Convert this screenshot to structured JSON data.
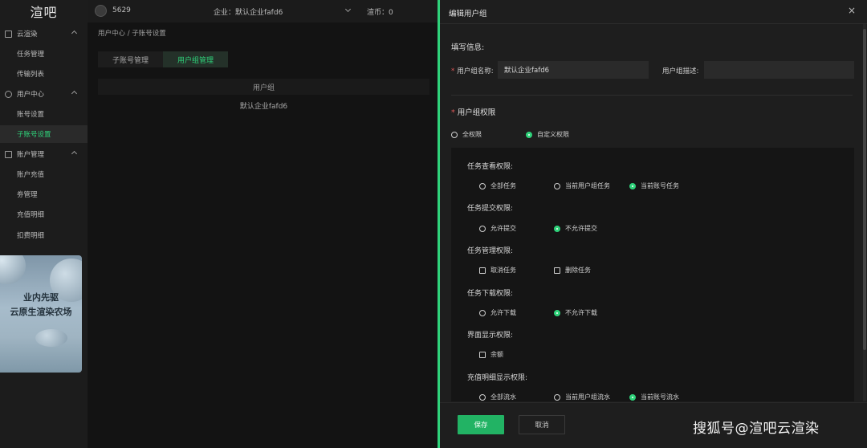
{
  "app": {
    "logo": "渲吧"
  },
  "sidebar": {
    "groups": [
      {
        "label": "云渲染",
        "items": [
          "任务管理",
          "传输列表"
        ]
      },
      {
        "label": "用户中心",
        "items": [
          "账号设置",
          "子账号设置"
        ]
      },
      {
        "label": "账户管理",
        "items": [
          "账户充值",
          "劵管理",
          "充值明细",
          "扣费明细"
        ]
      }
    ],
    "active_item": "子账号设置",
    "promo": {
      "line1": "业内先驱",
      "line2": "云原生渲染农场"
    }
  },
  "topbar": {
    "user_id": "5629",
    "company": "企业：默认企业fafd6",
    "balance": "渲币：0"
  },
  "main": {
    "breadcrumb": "用户中心 / 子账号设置",
    "tabs": [
      {
        "label": "子账号管理"
      },
      {
        "label": "用户组管理"
      }
    ],
    "table": {
      "header": "用户组",
      "rows": [
        "默认企业fafd6"
      ]
    }
  },
  "drawer": {
    "title": "编辑用户组",
    "close": "×",
    "info_label": "填写信息:",
    "group_name_label": "用户组名称:",
    "group_name_value": "默认企业fafd6",
    "group_desc_label": "用户组描述:",
    "group_desc_value": "",
    "perm_label": "用户组权限",
    "perm_mode": {
      "options": [
        "全权限",
        "自定义权限"
      ],
      "selected": 1
    },
    "permissions": [
      {
        "title": "任务查看权限:",
        "type": "radio",
        "options": [
          "全部任务",
          "当前用户组任务",
          "当前账号任务"
        ],
        "selected": 2
      },
      {
        "title": "任务提交权限:",
        "type": "radio",
        "options": [
          "允许提交",
          "不允许提交"
        ],
        "selected": 1
      },
      {
        "title": "任务管理权限:",
        "type": "checkbox",
        "options": [
          "取消任务",
          "删除任务"
        ],
        "checked": []
      },
      {
        "title": "任务下载权限:",
        "type": "radio",
        "options": [
          "允许下载",
          "不允许下载"
        ],
        "selected": 1
      },
      {
        "title": "界面显示权限:",
        "type": "checkbox",
        "options": [
          "余额"
        ],
        "checked": []
      },
      {
        "title": "充值明细显示权限:",
        "type": "radio",
        "options": [
          "全部流水",
          "当前用户组流水",
          "当前账号流水"
        ],
        "selected": 2
      }
    ],
    "save_label": "保存",
    "cancel_label": "取消"
  },
  "watermark": "搜狐号@渲吧云渲染",
  "colors": {
    "accent": "#2fd27a",
    "save_button": "#22b364",
    "required": "#e05858"
  }
}
